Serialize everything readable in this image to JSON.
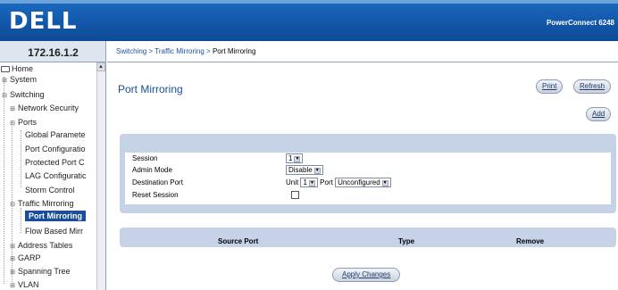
{
  "header": {
    "logo_text": "DELL",
    "product_name": "PowerConnect 6248"
  },
  "sidebar": {
    "ip_address": "172.16.1.2",
    "items": [
      {
        "label": "Home",
        "icon": "folder-icon"
      },
      {
        "label": "System",
        "icon": "expand-icon"
      },
      {
        "label": "Switching",
        "icon": "collapse-icon"
      },
      {
        "label": "Network Security",
        "icon": "expand-icon"
      },
      {
        "label": "Ports",
        "icon": "collapse-icon"
      },
      {
        "label": "Global Paramete"
      },
      {
        "label": "Port Configuratio"
      },
      {
        "label": "Protected Port C"
      },
      {
        "label": "LAG Configuratic"
      },
      {
        "label": "Storm Control"
      },
      {
        "label": "Traffic Mirroring",
        "icon": "collapse-icon"
      },
      {
        "label": "Port Mirroring"
      },
      {
        "label": "Flow Based Mirr"
      },
      {
        "label": "Address Tables",
        "icon": "expand-icon"
      },
      {
        "label": "GARP",
        "icon": "expand-icon"
      },
      {
        "label": "Spanning Tree",
        "icon": "expand-icon"
      },
      {
        "label": "VLAN",
        "icon": "expand-icon"
      }
    ]
  },
  "breadcrumb": {
    "items": [
      "Switching",
      "Traffic Mirroring",
      "Port Mirroring"
    ],
    "separator": ">"
  },
  "page": {
    "title": "Port Mirroring",
    "print_label": "Print",
    "refresh_label": "Refresh",
    "add_label": "Add"
  },
  "form": {
    "session_label": "Session",
    "session_value": "1",
    "admin_mode_label": "Admin Mode",
    "admin_mode_value": "Disable",
    "destination_port_label": "Destination Port",
    "unit_label": "Unit",
    "unit_value": "1",
    "port_label": "Port",
    "port_value": "Unconfigured",
    "reset_session_label": "Reset Session",
    "reset_session_checked": false
  },
  "source_table": {
    "columns": [
      "Source Port",
      "Type",
      "Remove"
    ]
  },
  "apply_label": "Apply Changes",
  "colors": {
    "banner": "#1256a8",
    "panel": "#c6d2e6",
    "selected": "#1a4e9a",
    "link": "#1a4e9a"
  }
}
